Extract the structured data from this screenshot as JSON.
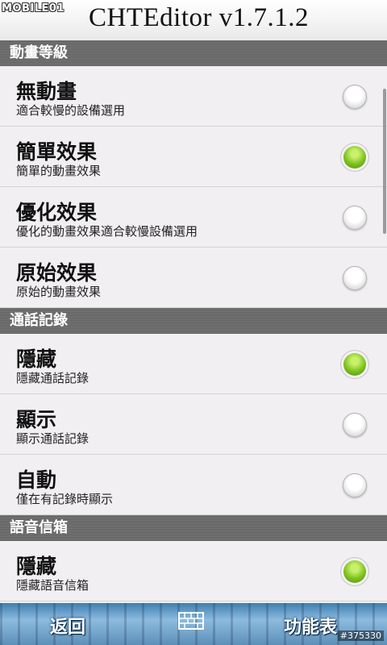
{
  "watermark": "MOBILE01",
  "app_title": "CHTEditor v1.7.1.2",
  "sections": [
    {
      "label": "動畫等級",
      "items": [
        {
          "title": "無動畫",
          "subtitle": "適合較慢的設備選用",
          "checked": false
        },
        {
          "title": "簡單效果",
          "subtitle": "簡單的動畫效果",
          "checked": true
        },
        {
          "title": "優化效果",
          "subtitle": "優化的動畫效果適合較慢設備選用",
          "checked": false
        },
        {
          "title": "原始效果",
          "subtitle": "原始的動畫效果",
          "checked": false
        }
      ]
    },
    {
      "label": "通話記錄",
      "items": [
        {
          "title": "隱藏",
          "subtitle": "隱藏通話記錄",
          "checked": true
        },
        {
          "title": "顯示",
          "subtitle": "顯示通話記錄",
          "checked": false
        },
        {
          "title": "自動",
          "subtitle": "僅在有記錄時顯示",
          "checked": false
        }
      ]
    },
    {
      "label": "語音信箱",
      "items": [
        {
          "title": "隱藏",
          "subtitle": "隱藏語音信箱",
          "checked": true
        }
      ]
    }
  ],
  "bottom_bar": {
    "back_label": "返回",
    "menu_label": "功能表",
    "keyboard_icon": "keyboard-icon"
  },
  "footer_id": "#375330",
  "colors": {
    "radio_checked": "#7fc31f",
    "section_bg": "#6e6e6e",
    "list_bg": "#f1eff2"
  }
}
